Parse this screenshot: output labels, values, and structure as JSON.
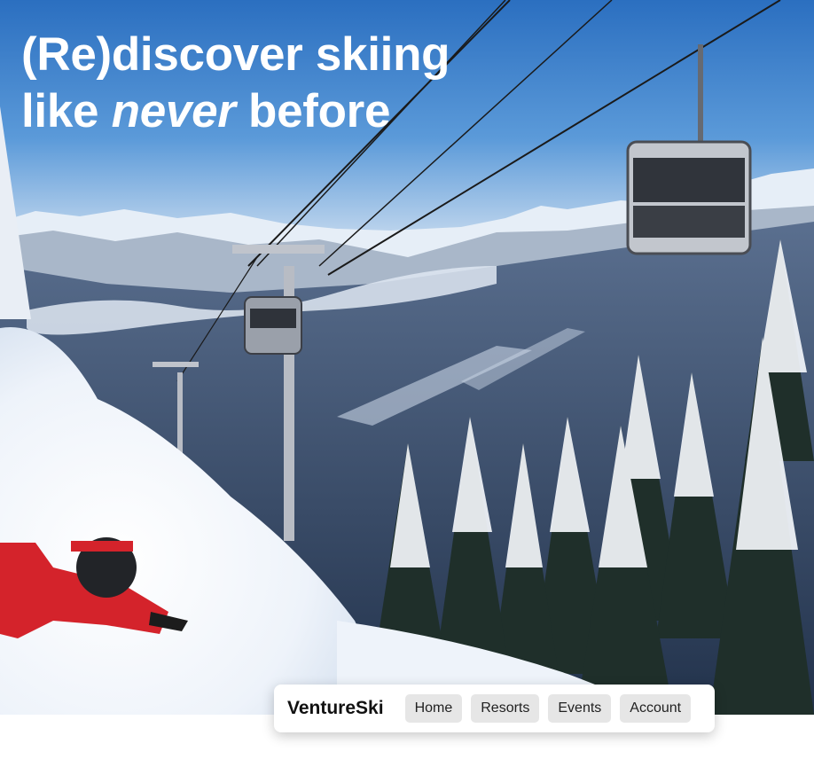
{
  "hero": {
    "headline_line1": "(Re)discover skiing",
    "headline_line2_part1": "like ",
    "headline_line2_emphasis": "never",
    "headline_line2_part2": " before",
    "image_description_icon": "hero-photo"
  },
  "nav": {
    "brand": "VentureSki",
    "items": [
      {
        "label": "Home"
      },
      {
        "label": "Resorts"
      },
      {
        "label": "Events"
      },
      {
        "label": "Account"
      }
    ]
  },
  "colors": {
    "sky": "#3f86d2",
    "snow": "#ffffff",
    "nav_button_bg": "#e6e6e6",
    "jacket": "#d6232b"
  }
}
